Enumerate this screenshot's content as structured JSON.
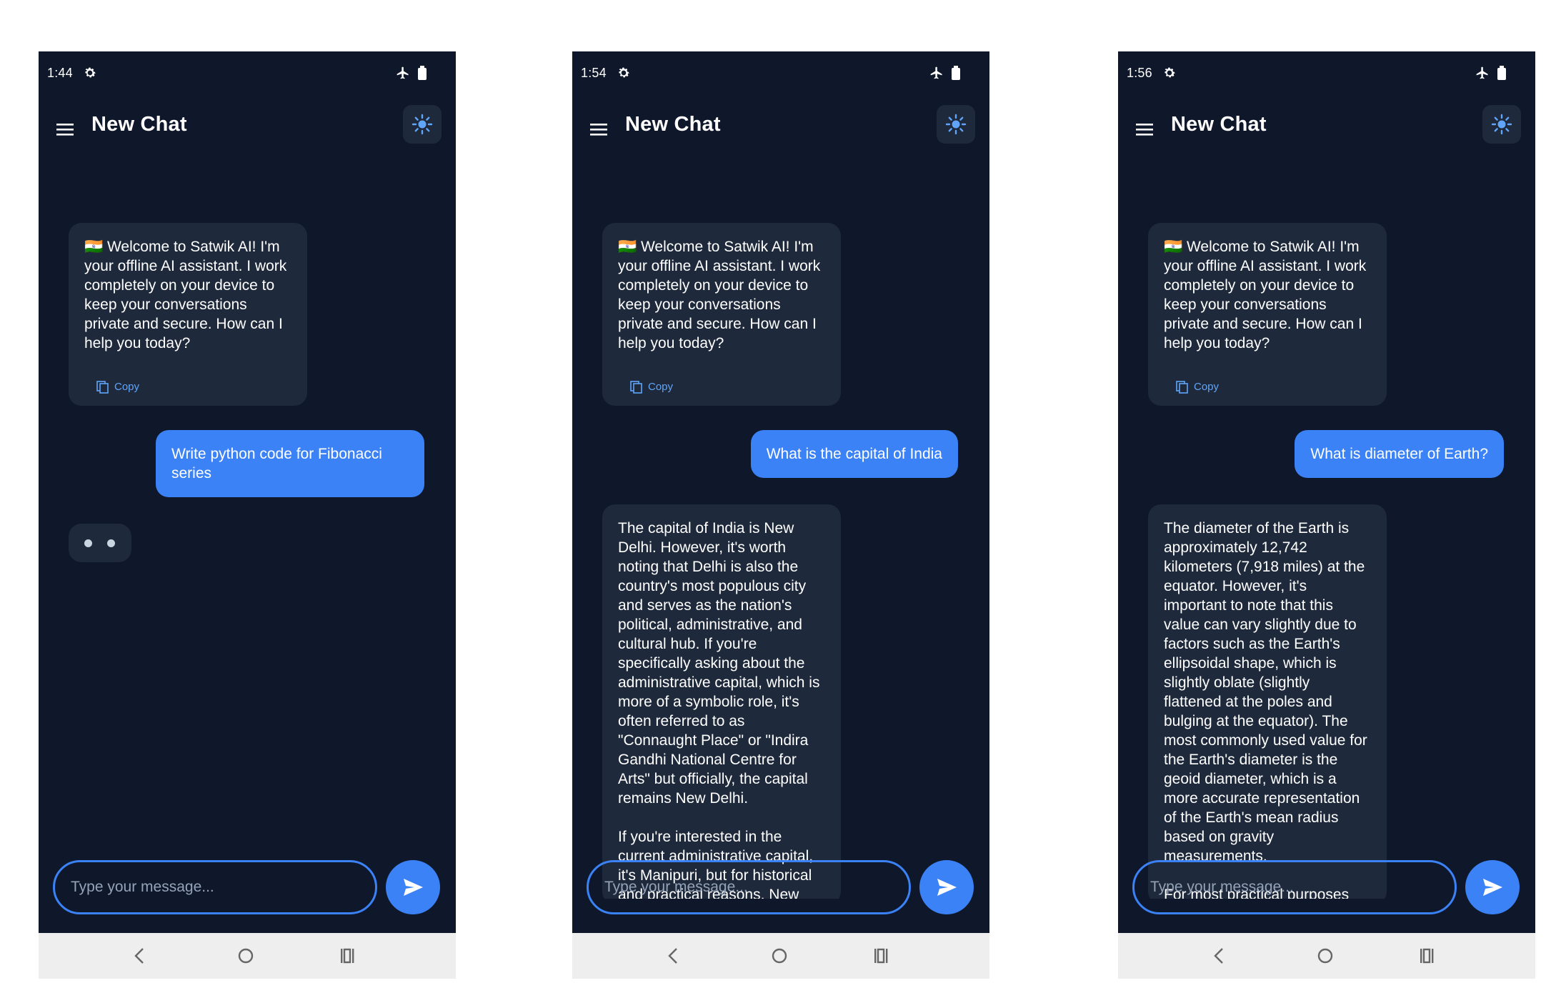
{
  "colors": {
    "background": "#0f172a",
    "bubble_bot": "#1e293b",
    "accent": "#3b82f6",
    "link": "#60a5fa",
    "nav_bar": "#eeeeee"
  },
  "screens": [
    {
      "status": {
        "time": "1:44"
      },
      "header": {
        "title": "New Chat"
      },
      "welcome": {
        "text": "🇮🇳 Welcome to Satwik AI! I'm your offline AI assistant. I work completely on your device to keep your conversations private and secure. How can I help you today?",
        "copy_label": "Copy"
      },
      "user_message": "Write python code for Fibonacci series",
      "input": {
        "placeholder": "Type your message..."
      },
      "icons": [
        "gear-icon",
        "airplane-icon",
        "battery-icon",
        "menu-icon",
        "sun-icon",
        "copy-icon",
        "send-icon",
        "back-icon",
        "home-icon",
        "recents-icon"
      ]
    },
    {
      "status": {
        "time": "1:54"
      },
      "header": {
        "title": "New Chat"
      },
      "welcome": {
        "text": "🇮🇳 Welcome to Satwik AI! I'm your offline AI assistant. I work completely on your device to keep your conversations private and secure. How can I help you today?",
        "copy_label": "Copy"
      },
      "user_message": "What is the capital of India",
      "bot_reply": {
        "p1": "The capital of India is New Delhi. However, it's worth noting that Delhi is also the country's most populous city and serves as the nation's political, administrative, and cultural hub. If you're specifically asking about the administrative capital, which is more of a symbolic role, it's often referred to as \"Connaught Place\" or \"Indira Gandhi National Centre for Arts\" but officially, the capital remains New Delhi.",
        "p2": "If you're interested in the current administrative capital, it's Manipuri, but for historical and practical reasons, New"
      },
      "input": {
        "placeholder": "Type your message..."
      }
    },
    {
      "status": {
        "time": "1:56"
      },
      "header": {
        "title": "New Chat"
      },
      "welcome": {
        "text": "🇮🇳 Welcome to Satwik AI! I'm your offline AI assistant. I work completely on your device to keep your conversations private and secure. How can I help you today?",
        "copy_label": "Copy"
      },
      "user_message": "What is diameter of Earth?",
      "bot_reply": {
        "p1": "The diameter of the Earth is approximately 12,742 kilometers (7,918 miles) at the equator. However, it's important to note that this value can vary slightly due to factors such as the Earth's ellipsoidal shape, which is slightly oblate (slightly flattened at the poles and bulging at the equator). The most commonly used value for the Earth's diameter is the geoid diameter, which is a more accurate representation of the Earth's mean radius based on gravity measurements.",
        "p2": "For most practical purposes"
      },
      "input": {
        "placeholder": "Type your message..."
      }
    }
  ]
}
